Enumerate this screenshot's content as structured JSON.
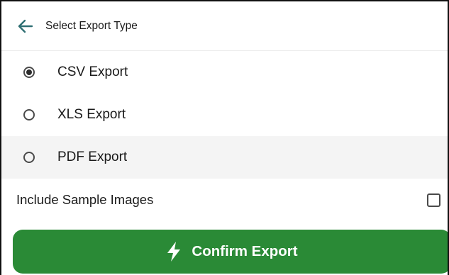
{
  "header": {
    "title": "Select Export Type",
    "back_icon": "arrow-left-icon",
    "accent_color": "#2f6f73"
  },
  "export_options": [
    {
      "label": "CSV Export",
      "selected": true
    },
    {
      "label": "XLS Export",
      "selected": false
    },
    {
      "label": "PDF Export",
      "selected": false
    }
  ],
  "include_sample_images": {
    "label": "Include Sample Images",
    "checked": false
  },
  "confirm_button": {
    "label": "Confirm Export",
    "icon": "lightning-bolt-icon",
    "color": "#2a8a36"
  }
}
